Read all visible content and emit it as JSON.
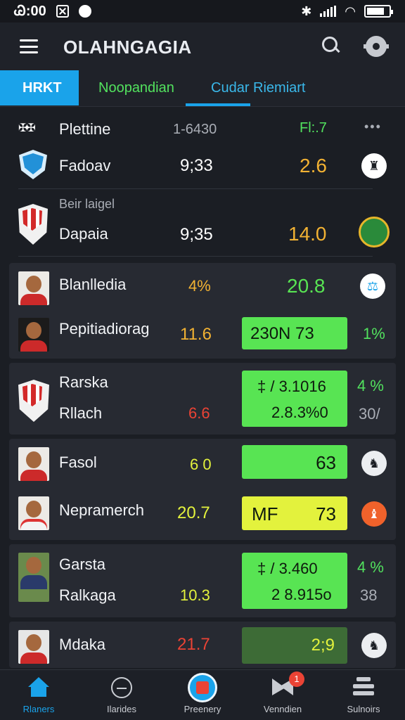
{
  "status_bar": {
    "time": "Ꮚ:00"
  },
  "header": {
    "title": "OLAHNGAGIA"
  },
  "tabs": [
    {
      "label": "HRKT"
    },
    {
      "label": "Noopandian"
    },
    {
      "label": "Cudar Riemiart"
    }
  ],
  "colors": {
    "accent": "#1aa3ea",
    "green": "#58e453",
    "yellow": "#e3f23d",
    "orange": "#f2b233",
    "red": "#ea4335"
  },
  "rows": {
    "r1": {
      "name": "Plettine",
      "value": "1-6430",
      "metric": "Fl:.7",
      "more": "•••"
    },
    "r2": {
      "name": "Fadoav",
      "value": "9;33",
      "metric": "2.6"
    },
    "r3": {
      "label": "Beir laigel",
      "name": "Dapaia",
      "value": "9;35",
      "metric": "14.0"
    }
  },
  "cards": {
    "c1": {
      "name_a": "Blanlledia",
      "pct_a": "4%",
      "value_a": "20.8",
      "name_b": "Pepitiadiorag",
      "value_b": "11.6",
      "box": "230N  73",
      "pct_b": "1%"
    },
    "c2": {
      "name_a": "Rarska",
      "name_b": "Rllach",
      "value_b": "6.6",
      "box_a": "‡ / 3.1016",
      "box_b": "2.8.3%0",
      "pct_a": "4 %",
      "pct_b": "30/"
    },
    "c3": {
      "name_a": "Fasol",
      "value_a": "6 0",
      "box_a": "63",
      "name_b": "Nepramerch",
      "value_b": "20.7",
      "box_b_left": "MF",
      "box_b_right": "73"
    },
    "c4": {
      "name_a": "Garsta",
      "name_b": "Ralkaga",
      "value_b": "10.3",
      "box_a": "‡ / 3.460",
      "box_b": "2 8.915o",
      "pct_a": "4 %",
      "pct_b": "38"
    },
    "c5": {
      "name": "Mdaka",
      "value": "21.7",
      "box": "2;9"
    }
  },
  "bottom_nav": [
    {
      "label": "Rlaners",
      "icon": "home-icon"
    },
    {
      "label": "Ilarides",
      "icon": "gauge-icon"
    },
    {
      "label": "Preenery",
      "icon": "ball-icon"
    },
    {
      "label": "Venndien",
      "icon": "flag-icon",
      "badge": "1"
    },
    {
      "label": "Sulnoirs",
      "icon": "stack-icon"
    }
  ]
}
